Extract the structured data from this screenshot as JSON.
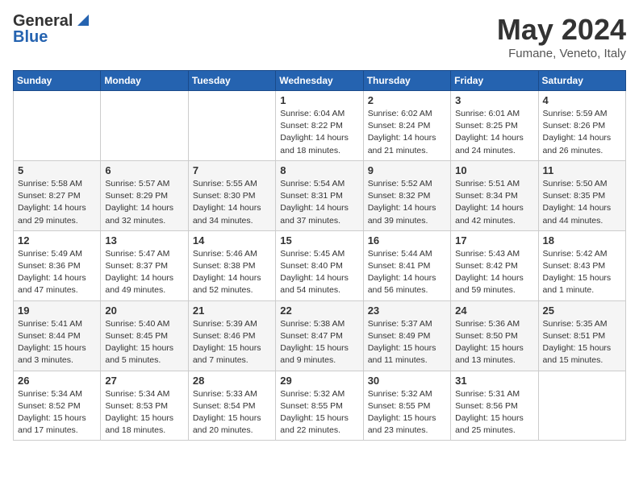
{
  "logo": {
    "general": "General",
    "blue": "Blue"
  },
  "header": {
    "month": "May 2024",
    "location": "Fumane, Veneto, Italy"
  },
  "weekdays": [
    "Sunday",
    "Monday",
    "Tuesday",
    "Wednesday",
    "Thursday",
    "Friday",
    "Saturday"
  ],
  "weeks": [
    [
      {
        "day": "",
        "info": ""
      },
      {
        "day": "",
        "info": ""
      },
      {
        "day": "",
        "info": ""
      },
      {
        "day": "1",
        "info": "Sunrise: 6:04 AM\nSunset: 8:22 PM\nDaylight: 14 hours and 18 minutes."
      },
      {
        "day": "2",
        "info": "Sunrise: 6:02 AM\nSunset: 8:24 PM\nDaylight: 14 hours and 21 minutes."
      },
      {
        "day": "3",
        "info": "Sunrise: 6:01 AM\nSunset: 8:25 PM\nDaylight: 14 hours and 24 minutes."
      },
      {
        "day": "4",
        "info": "Sunrise: 5:59 AM\nSunset: 8:26 PM\nDaylight: 14 hours and 26 minutes."
      }
    ],
    [
      {
        "day": "5",
        "info": "Sunrise: 5:58 AM\nSunset: 8:27 PM\nDaylight: 14 hours and 29 minutes."
      },
      {
        "day": "6",
        "info": "Sunrise: 5:57 AM\nSunset: 8:29 PM\nDaylight: 14 hours and 32 minutes."
      },
      {
        "day": "7",
        "info": "Sunrise: 5:55 AM\nSunset: 8:30 PM\nDaylight: 14 hours and 34 minutes."
      },
      {
        "day": "8",
        "info": "Sunrise: 5:54 AM\nSunset: 8:31 PM\nDaylight: 14 hours and 37 minutes."
      },
      {
        "day": "9",
        "info": "Sunrise: 5:52 AM\nSunset: 8:32 PM\nDaylight: 14 hours and 39 minutes."
      },
      {
        "day": "10",
        "info": "Sunrise: 5:51 AM\nSunset: 8:34 PM\nDaylight: 14 hours and 42 minutes."
      },
      {
        "day": "11",
        "info": "Sunrise: 5:50 AM\nSunset: 8:35 PM\nDaylight: 14 hours and 44 minutes."
      }
    ],
    [
      {
        "day": "12",
        "info": "Sunrise: 5:49 AM\nSunset: 8:36 PM\nDaylight: 14 hours and 47 minutes."
      },
      {
        "day": "13",
        "info": "Sunrise: 5:47 AM\nSunset: 8:37 PM\nDaylight: 14 hours and 49 minutes."
      },
      {
        "day": "14",
        "info": "Sunrise: 5:46 AM\nSunset: 8:38 PM\nDaylight: 14 hours and 52 minutes."
      },
      {
        "day": "15",
        "info": "Sunrise: 5:45 AM\nSunset: 8:40 PM\nDaylight: 14 hours and 54 minutes."
      },
      {
        "day": "16",
        "info": "Sunrise: 5:44 AM\nSunset: 8:41 PM\nDaylight: 14 hours and 56 minutes."
      },
      {
        "day": "17",
        "info": "Sunrise: 5:43 AM\nSunset: 8:42 PM\nDaylight: 14 hours and 59 minutes."
      },
      {
        "day": "18",
        "info": "Sunrise: 5:42 AM\nSunset: 8:43 PM\nDaylight: 15 hours and 1 minute."
      }
    ],
    [
      {
        "day": "19",
        "info": "Sunrise: 5:41 AM\nSunset: 8:44 PM\nDaylight: 15 hours and 3 minutes."
      },
      {
        "day": "20",
        "info": "Sunrise: 5:40 AM\nSunset: 8:45 PM\nDaylight: 15 hours and 5 minutes."
      },
      {
        "day": "21",
        "info": "Sunrise: 5:39 AM\nSunset: 8:46 PM\nDaylight: 15 hours and 7 minutes."
      },
      {
        "day": "22",
        "info": "Sunrise: 5:38 AM\nSunset: 8:47 PM\nDaylight: 15 hours and 9 minutes."
      },
      {
        "day": "23",
        "info": "Sunrise: 5:37 AM\nSunset: 8:49 PM\nDaylight: 15 hours and 11 minutes."
      },
      {
        "day": "24",
        "info": "Sunrise: 5:36 AM\nSunset: 8:50 PM\nDaylight: 15 hours and 13 minutes."
      },
      {
        "day": "25",
        "info": "Sunrise: 5:35 AM\nSunset: 8:51 PM\nDaylight: 15 hours and 15 minutes."
      }
    ],
    [
      {
        "day": "26",
        "info": "Sunrise: 5:34 AM\nSunset: 8:52 PM\nDaylight: 15 hours and 17 minutes."
      },
      {
        "day": "27",
        "info": "Sunrise: 5:34 AM\nSunset: 8:53 PM\nDaylight: 15 hours and 18 minutes."
      },
      {
        "day": "28",
        "info": "Sunrise: 5:33 AM\nSunset: 8:54 PM\nDaylight: 15 hours and 20 minutes."
      },
      {
        "day": "29",
        "info": "Sunrise: 5:32 AM\nSunset: 8:55 PM\nDaylight: 15 hours and 22 minutes."
      },
      {
        "day": "30",
        "info": "Sunrise: 5:32 AM\nSunset: 8:55 PM\nDaylight: 15 hours and 23 minutes."
      },
      {
        "day": "31",
        "info": "Sunrise: 5:31 AM\nSunset: 8:56 PM\nDaylight: 15 hours and 25 minutes."
      },
      {
        "day": "",
        "info": ""
      }
    ]
  ]
}
